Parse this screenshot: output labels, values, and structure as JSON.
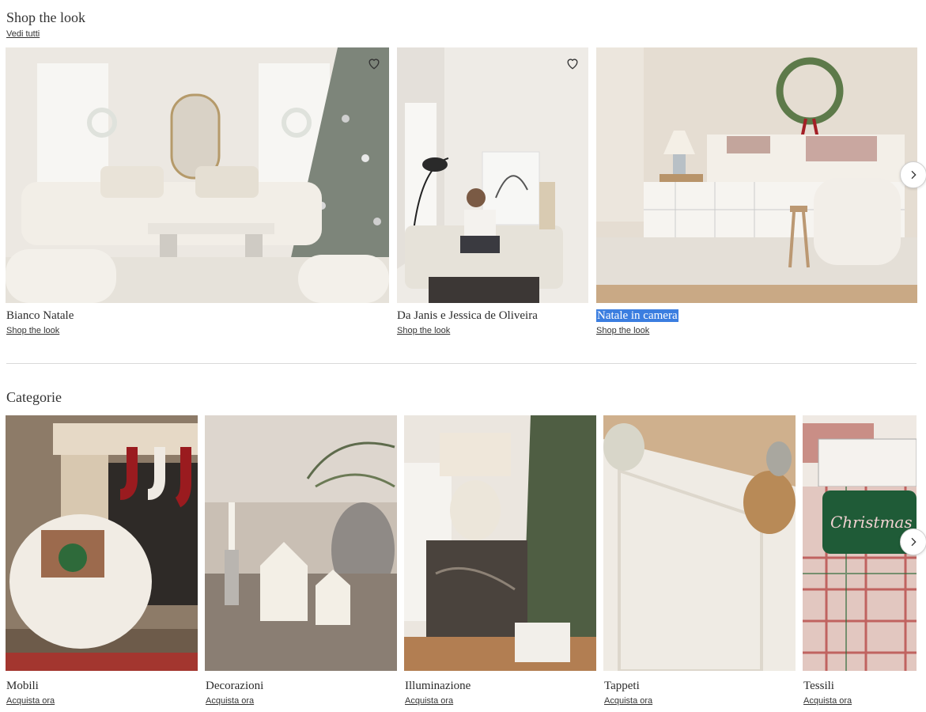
{
  "shop_the_look": {
    "title": "Shop the look",
    "see_all": "Vedi tutti",
    "looks": [
      {
        "title": "Bianco Natale",
        "link": "Shop the look"
      },
      {
        "title": "Da Janis e Jessica de Oliveira",
        "link": "Shop the look"
      },
      {
        "title": "Natale in camera",
        "link": "Shop the look"
      }
    ]
  },
  "categories": {
    "title": "Categorie",
    "items": [
      {
        "title": "Mobili",
        "link": "Acquista ora"
      },
      {
        "title": "Decorazioni",
        "link": "Acquista ora"
      },
      {
        "title": "Illuminazione",
        "link": "Acquista ora"
      },
      {
        "title": "Tappeti",
        "link": "Acquista ora"
      },
      {
        "title": "Tessili",
        "link": "Acquista ora"
      }
    ]
  },
  "icons": {
    "favorite": "heart-outline-icon",
    "next": "chevron-right-icon"
  },
  "colors": {
    "selection": "#3b7ee0",
    "divider": "#d9d9d9"
  }
}
